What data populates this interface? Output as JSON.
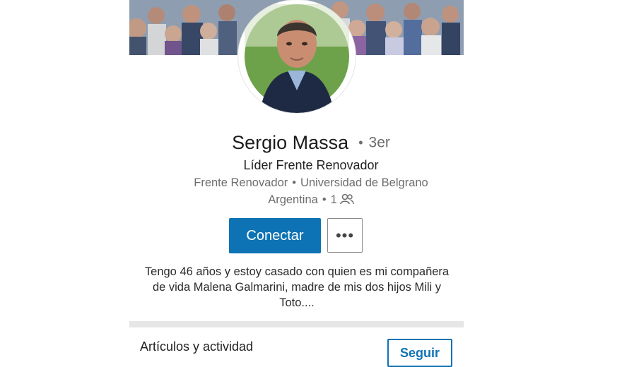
{
  "profile": {
    "name": "Sergio Massa",
    "degree": "3er",
    "headline": "Líder Frente Renovador",
    "company": "Frente Renovador",
    "school": "Universidad de Belgrano",
    "location": "Argentina",
    "connections": "1",
    "summary": "Tengo 46 años y estoy casado con quien es mi compañera de vida Malena Galmarini, madre de mis dos hijos Mili y Toto...."
  },
  "actions": {
    "connect_label": "Conectar",
    "more_label": "•••"
  },
  "activity": {
    "title": "Artículos y actividad",
    "follow_label": "Seguir"
  },
  "icons": {
    "connections": "people-icon",
    "more": "more-horizontal-icon"
  },
  "colors": {
    "primary": "#0e73b4",
    "divider": "#e6e6e6"
  }
}
